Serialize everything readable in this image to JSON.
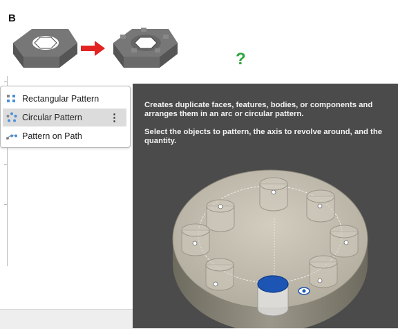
{
  "figure": {
    "section_label": "B",
    "question_mark": "?",
    "arrow_color": "#e32222",
    "question_color": "#2aa63c"
  },
  "menu": {
    "items": [
      {
        "label": "Rectangular Pattern",
        "icon": "rectangular-pattern-icon"
      },
      {
        "label": "Circular Pattern",
        "icon": "circular-pattern-icon",
        "active": true
      },
      {
        "label": "Pattern on Path",
        "icon": "pattern-on-path-icon"
      }
    ],
    "more_glyph": "⋮"
  },
  "tooltip": {
    "description": "Creates duplicate faces, features, bodies, or components and arranges them in an arc or circular pattern.",
    "instructions": "Select the objects to pattern, the axis to revolve around, and the quantity."
  }
}
